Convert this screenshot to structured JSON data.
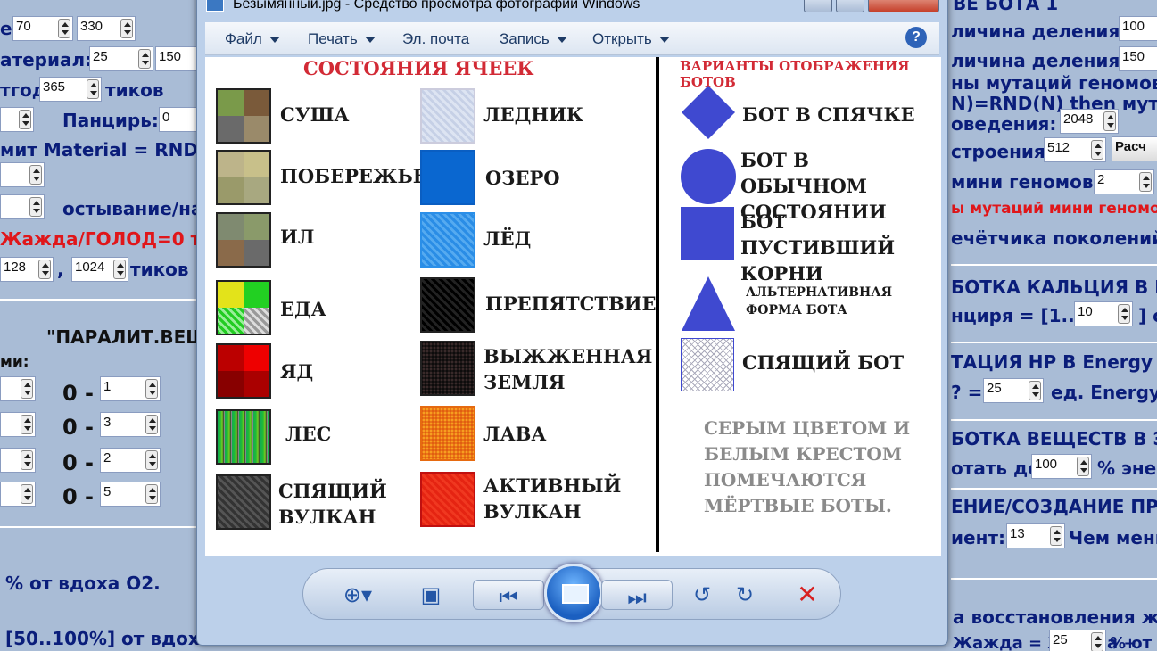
{
  "background": {
    "texts": [
      "е:",
      "атериал:",
      "тгод",
      "тиков",
      "Панцирь:",
      "мит Material = RND(",
      "остывание/на",
      "Жажда/ГОЛОД=0 тогда",
      ",",
      "тиков",
      "\"ПАРАЛИТ.ВЕЩ",
      "ми:",
      "% от вдоха О2.",
      "[50..100%] от вдоха",
      "личина деления:",
      "личина деления:",
      "ны мутаций геномов",
      "N)=RND(N) then мута",
      "оведения:",
      "строения:",
      "Расч",
      "мини геномов:",
      "ы мутаций мини геномов",
      "ечётчика поколений:",
      "БОТКА КАЛЬЦИЯ В ПА",
      "нциря = [1..",
      "] с",
      "ТАЦИЯ HP В Energy (к",
      "? =",
      "ед. Energy",
      "БОТКА ВЕЩЕСТВ В ЭН",
      "отать до",
      "% энер",
      "ЕНИЕ/СОЗДАНИЕ ПР",
      "иент:",
      "Чем мень",
      "а восстановления жа",
      "Жажда = Жажда +",
      "% от",
      "ВЕ БОТА 1",
      "ЖАЖДА"
    ],
    "zeros": [
      "0 -",
      "0 -",
      "0 -",
      "0 -"
    ],
    "values": [
      "70",
      "330",
      "25",
      "150",
      "365",
      "0",
      "128",
      "1024",
      "1",
      "3",
      "2",
      "5",
      "100",
      "150",
      "2048",
      "512",
      "2",
      "10",
      "25",
      "100",
      "13",
      "25"
    ]
  },
  "window": {
    "title": "Безымянный.jpg - Средство просмотра фотографий Windows",
    "menu": [
      {
        "label": "Файл",
        "dropdown": true
      },
      {
        "label": "Печать",
        "dropdown": true
      },
      {
        "label": "Эл. почта",
        "dropdown": false
      },
      {
        "label": "Запись",
        "dropdown": true
      },
      {
        "label": "Открыть",
        "dropdown": true
      }
    ],
    "help_icon": "help-icon"
  },
  "photo": {
    "left_title": "СОСТОЯНИЯ ЯЧЕЕК",
    "right_title": "ВАРИАНТЫ ОТОБРАЖЕНИЯ БОТОВ",
    "cells_col1": [
      "СУША",
      "ПОБЕРЕЖЬЕ",
      "ИЛ",
      "ЕДА",
      "ЯД",
      "ЛЕС",
      "СПЯЩИЙ ВУЛКАН"
    ],
    "cells_col2": [
      "ЛЕДНИК",
      "ОЗЕРО",
      "ЛЁД",
      "ПРЕПЯТСТВИЕ",
      "ВЫЖЖЕННАЯ ЗЕМЛЯ",
      "ЛАВА",
      "АКТИВНЫЙ ВУЛКАН"
    ],
    "bots": [
      "БОТ В СПЯЧКЕ",
      "БОТ В ОБЫЧНОМ СОСТОЯНИИ",
      "БОТ ПУСТИВШИЙ КОРНИ",
      "АЛЬТЕРНАТИВНАЯ ФОРМА БОТА",
      "СПЯЩИЙ БОТ"
    ],
    "note": "СЕРЫМ ЦВЕТОМ И БЕЛЫМ КРЕСТОМ ПОМЕЧАЮТСЯ МЁРТВЫЕ БОТЫ.",
    "bot_color": "#3f49d0"
  },
  "bottom_bar": {
    "tools": [
      "zoom-icon",
      "fit-icon",
      "previous-icon",
      "slideshow-icon",
      "next-icon",
      "rotate-left-icon",
      "rotate-right-icon",
      "delete-icon"
    ]
  }
}
